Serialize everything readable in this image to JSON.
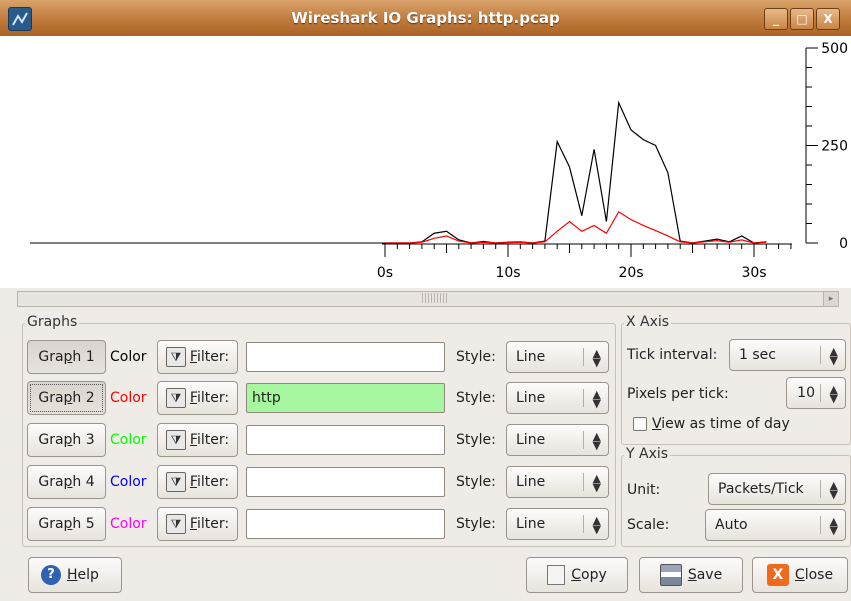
{
  "window": {
    "title": "Wireshark IO Graphs: http.pcap",
    "buttons": [
      "_",
      "□",
      "X"
    ]
  },
  "chart_data": {
    "type": "line",
    "y_ticks": [
      "500",
      "250",
      "0"
    ],
    "x_ticks": [
      "0s",
      "10s",
      "20s",
      "30s"
    ],
    "ylim": [
      0,
      500
    ],
    "xlim": [
      0,
      32
    ],
    "series": [
      {
        "color": "#000000",
        "x": [
          0,
          1,
          2,
          3,
          4,
          5,
          6,
          7,
          8,
          9,
          10,
          11,
          12,
          13,
          14,
          15,
          16,
          17,
          18,
          19,
          20,
          21,
          22,
          23,
          24,
          25,
          26,
          27,
          28,
          29,
          30,
          31
        ],
        "values": [
          0,
          0,
          0,
          3,
          25,
          30,
          8,
          0,
          4,
          0,
          2,
          3,
          0,
          5,
          260,
          195,
          70,
          240,
          55,
          360,
          290,
          265,
          250,
          180,
          5,
          0,
          5,
          10,
          3,
          18,
          0,
          3
        ]
      },
      {
        "color": "#ff0000",
        "x": [
          0,
          1,
          2,
          3,
          4,
          5,
          6,
          7,
          8,
          9,
          10,
          11,
          12,
          13,
          14,
          15,
          16,
          17,
          18,
          19,
          20,
          21,
          22,
          23,
          24,
          25,
          26,
          27,
          28,
          29,
          30,
          31
        ],
        "values": [
          0,
          0,
          0,
          2,
          12,
          18,
          5,
          0,
          2,
          0,
          1,
          2,
          0,
          3,
          30,
          55,
          30,
          45,
          25,
          80,
          60,
          45,
          32,
          18,
          3,
          0,
          3,
          6,
          2,
          8,
          0,
          2
        ]
      }
    ]
  },
  "graphs": {
    "label": "Graphs",
    "filter_label": "Filter:",
    "color_label": "Color",
    "style_label": "Style:",
    "rows": [
      {
        "button": "Graph 1",
        "color": "#000000",
        "filter": "",
        "style": "Line",
        "pressed": true
      },
      {
        "button": "Graph 2",
        "color": "#ff0000",
        "filter": "http",
        "style": "Line",
        "pressed": true
      },
      {
        "button": "Graph 3",
        "color": "#00ff00",
        "filter": "",
        "style": "Line",
        "pressed": false
      },
      {
        "button": "Graph 4",
        "color": "#0000ff",
        "filter": "",
        "style": "Line",
        "pressed": false
      },
      {
        "button": "Graph 5",
        "color": "#ff00ff",
        "filter": "",
        "style": "Line",
        "pressed": false
      }
    ]
  },
  "x_axis": {
    "label": "X Axis",
    "tick_interval_label": "Tick interval:",
    "tick_interval_value": "1 sec",
    "pixels_per_tick_label": "Pixels per tick:",
    "pixels_per_tick_value": "10",
    "view_time_of_day_label": "View as time of day",
    "view_time_of_day_checked": false
  },
  "y_axis": {
    "label": "Y Axis",
    "unit_label": "Unit:",
    "unit_value": "Packets/Tick",
    "scale_label": "Scale:",
    "scale_value": "Auto"
  },
  "footer": {
    "help": "Help",
    "copy": "Copy",
    "save": "Save",
    "close": "Close"
  }
}
